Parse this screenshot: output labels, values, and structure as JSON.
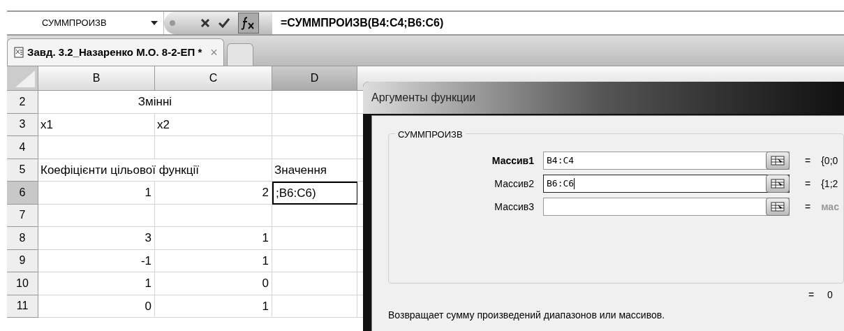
{
  "formula_bar": {
    "name_box": "СУММПРОИЗВ",
    "formula": "=СУММПРОИЗВ(B4:C4;B6:C6)"
  },
  "workbook_tab": {
    "label": "Завд. 3.2_Назаренко М.О. 8-2-ЕП *",
    "close": "×",
    "selected": true
  },
  "sheet": {
    "columns": [
      {
        "label": "B",
        "selected": false
      },
      {
        "label": "C",
        "selected": false
      },
      {
        "label": "D",
        "selected": true
      }
    ],
    "rows": [
      {
        "header": "2",
        "selected": false,
        "cells": [
          {
            "kind": "merged",
            "text": "Змінні",
            "colspan": 2,
            "selected": false
          },
          {
            "kind": "empty",
            "selected": false
          }
        ]
      },
      {
        "header": "3",
        "selected": false,
        "cells": [
          {
            "kind": "text",
            "text": "x1",
            "selected": false
          },
          {
            "kind": "text",
            "text": "x2",
            "selected": false
          },
          {
            "kind": "empty",
            "selected": false
          }
        ]
      },
      {
        "header": "4",
        "selected": false,
        "cells": [
          {
            "kind": "empty",
            "selected": false
          },
          {
            "kind": "empty",
            "selected": false
          },
          {
            "kind": "empty",
            "selected": false
          }
        ]
      },
      {
        "header": "5",
        "selected": false,
        "cells": [
          {
            "kind": "overflow",
            "text": "Коефіцієнти цільової функції",
            "colspan": 2,
            "selected": false
          },
          {
            "kind": "text",
            "text": "Значення",
            "selected": false
          }
        ]
      },
      {
        "header": "6",
        "selected": true,
        "cells": [
          {
            "kind": "number",
            "text": "1",
            "selected": false
          },
          {
            "kind": "number",
            "text": "2",
            "selected": false
          },
          {
            "kind": "text",
            "text": ";B6:C6)",
            "selected": true
          }
        ]
      },
      {
        "header": "7",
        "selected": false,
        "cells": [
          {
            "kind": "empty",
            "selected": false
          },
          {
            "kind": "empty",
            "selected": false
          },
          {
            "kind": "empty",
            "selected": false
          }
        ]
      },
      {
        "header": "8",
        "selected": false,
        "cells": [
          {
            "kind": "number",
            "text": "3",
            "selected": false
          },
          {
            "kind": "number",
            "text": "1",
            "selected": false
          },
          {
            "kind": "empty",
            "selected": false
          }
        ]
      },
      {
        "header": "9",
        "selected": false,
        "cells": [
          {
            "kind": "number",
            "text": "-1",
            "selected": false
          },
          {
            "kind": "number",
            "text": "1",
            "selected": false
          },
          {
            "kind": "empty",
            "selected": false
          }
        ]
      },
      {
        "header": "10",
        "selected": false,
        "cells": [
          {
            "kind": "number",
            "text": "1",
            "selected": false
          },
          {
            "kind": "number",
            "text": "0",
            "selected": false
          },
          {
            "kind": "empty",
            "selected": false
          }
        ]
      },
      {
        "header": "11",
        "selected": false,
        "cells": [
          {
            "kind": "number",
            "text": "0",
            "selected": false
          },
          {
            "kind": "number",
            "text": "1",
            "selected": false
          },
          {
            "kind": "empty",
            "selected": false
          }
        ]
      }
    ]
  },
  "dialog": {
    "title": "Аргументы функции",
    "function_name": "СУММПРОИЗВ",
    "arguments": [
      {
        "label": "Массив1",
        "required": true,
        "focused": false,
        "value": "B4:C4",
        "result": "{0;0",
        "result_muted": false
      },
      {
        "label": "Массив2",
        "required": false,
        "focused": true,
        "value": "B6:C6",
        "result": "{1;2",
        "result_muted": false
      },
      {
        "label": "Массив3",
        "required": false,
        "focused": false,
        "result": "мас",
        "result_muted": true
      }
    ],
    "equals": "=",
    "result": "0",
    "description": "Возвращает сумму произведений диапазонов или массивов."
  }
}
